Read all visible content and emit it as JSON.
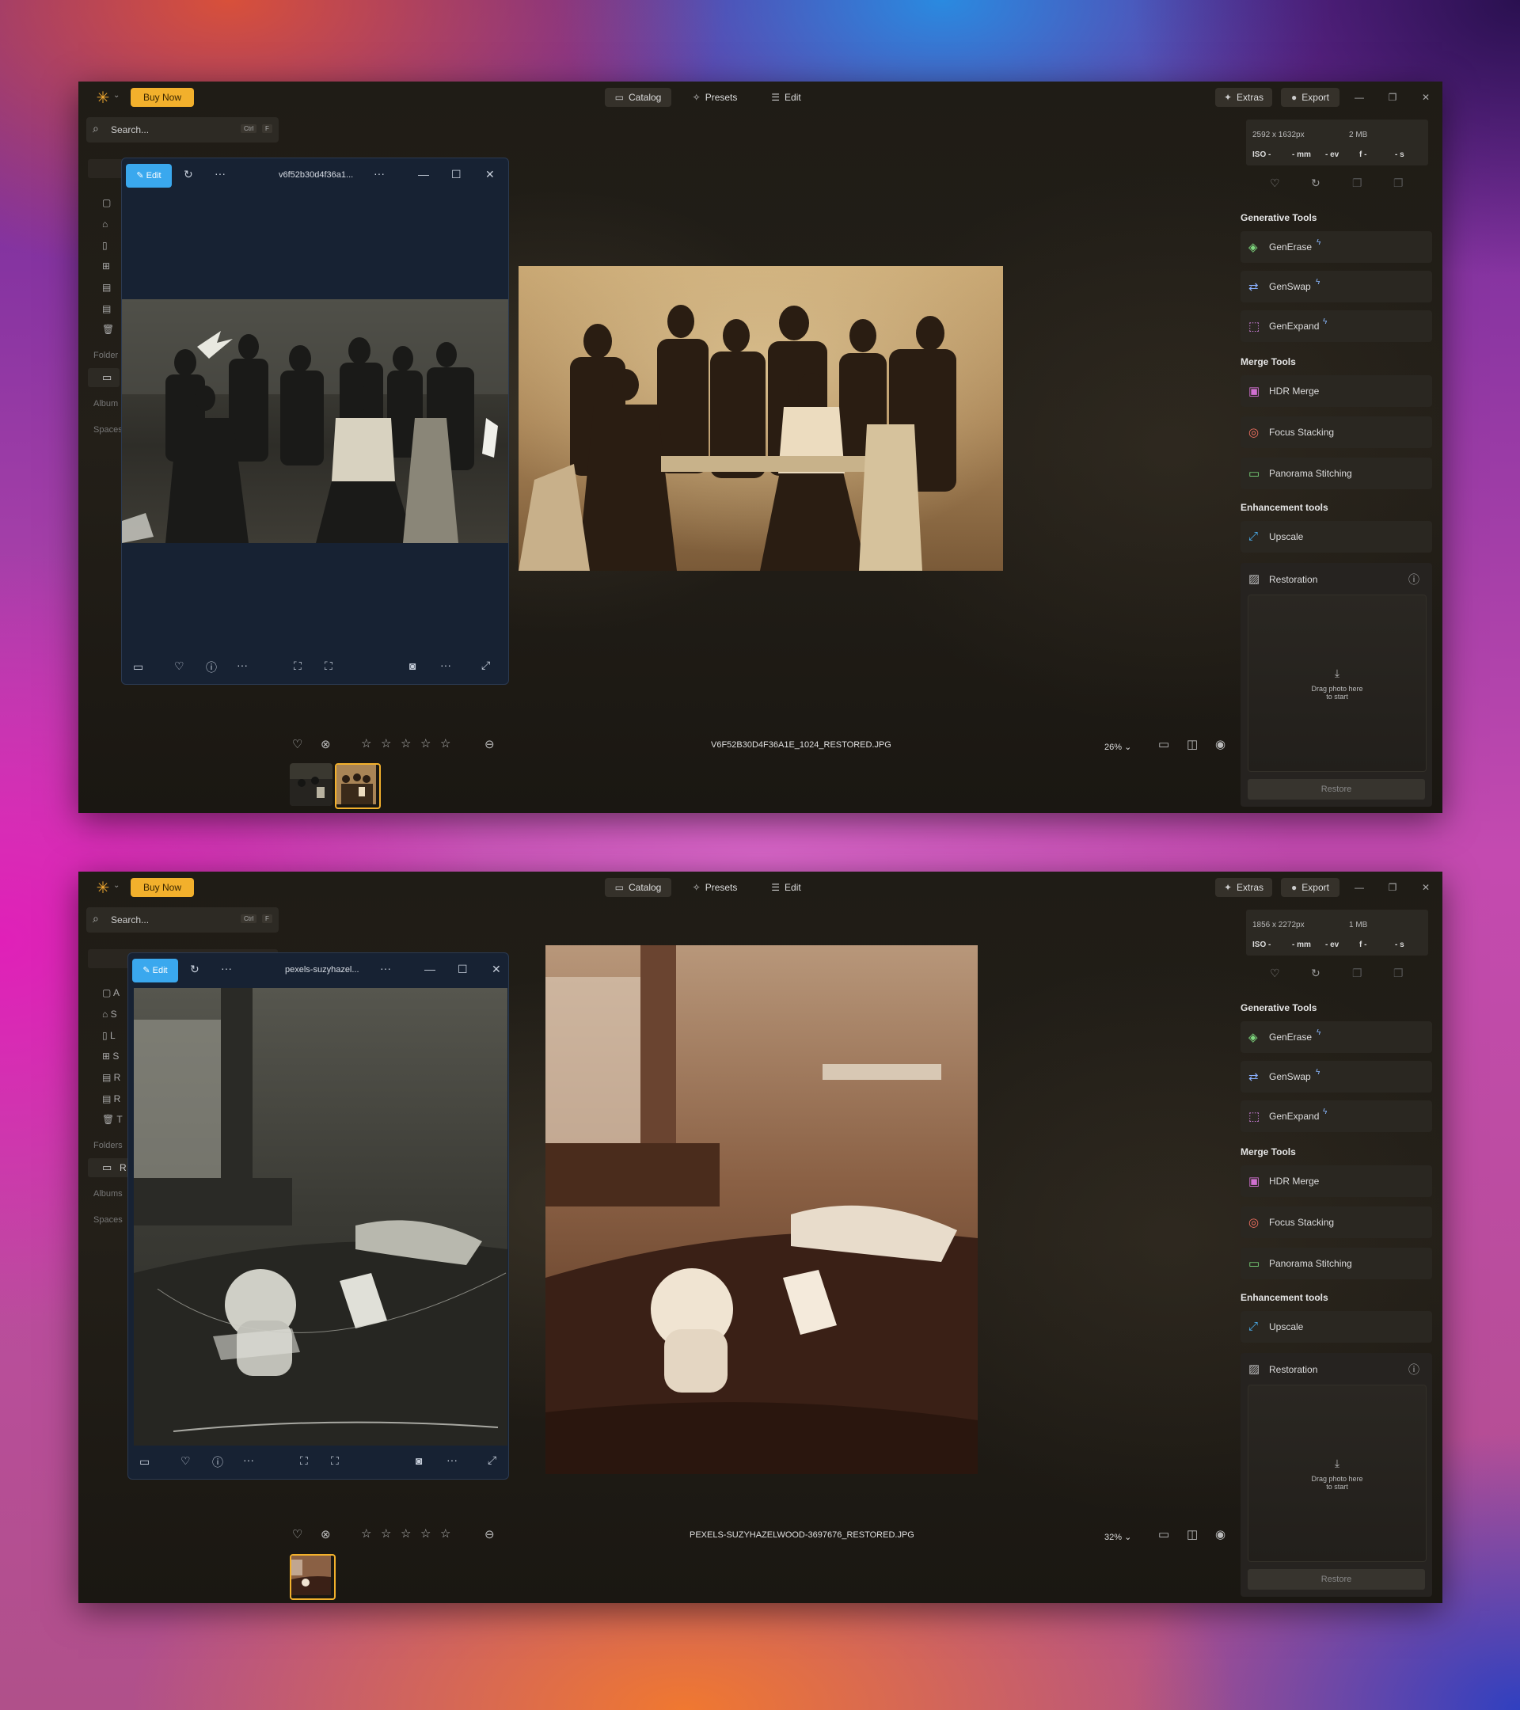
{
  "app": {
    "buy_now": "Buy Now",
    "search_placeholder": "Search...",
    "kbd_ctrl": "Ctrl",
    "kbd_f": "F",
    "nav": {
      "catalog": "Catalog",
      "presets": "Presets",
      "edit": "Edit"
    },
    "extras": "Extras",
    "export": "Export"
  },
  "sidebar": {
    "folders": "Folders",
    "albums": "Albums",
    "spaces": "Spaces",
    "w1_albums_cut": "Album",
    "w1_folders_cut": "Folder",
    "w2_item_letters": [
      "A",
      "S",
      "L",
      "S",
      "R",
      "R",
      "T"
    ],
    "w2_folder_letter": "R"
  },
  "viewer1": {
    "title": "v6f52b30d4f36a1...",
    "edit_label": "Edit"
  },
  "viewer2": {
    "title": "pexels-suzyhazel...",
    "edit_label": "Edit"
  },
  "window1": {
    "meta": {
      "resolution": "2592 x 1632px",
      "size": "2 MB",
      "iso": "ISO -",
      "mm": "- mm",
      "ev": "- ev",
      "f": "f -",
      "s": "- s"
    },
    "filename": "V6F52B30D4F36A1E_1024_RESTORED.JPG",
    "zoom": "26%"
  },
  "window2": {
    "meta": {
      "resolution": "1856 x 2272px",
      "size": "1 MB",
      "iso": "ISO -",
      "mm": "- mm",
      "ev": "- ev",
      "f": "f -",
      "s": "- s"
    },
    "filename": "PEXELS-SUZYHAZELWOOD-3697676_RESTORED.JPG",
    "zoom": "32%"
  },
  "tools": {
    "generative_title": "Generative Tools",
    "generative": [
      "GenErase",
      "GenSwap",
      "GenExpand"
    ],
    "merge_title": "Merge Tools",
    "merge": [
      "HDR Merge",
      "Focus Stacking",
      "Panorama Stitching"
    ],
    "enhancement_title": "Enhancement tools",
    "upscale": "Upscale",
    "restoration": "Restoration",
    "drop_line1": "Drag photo here",
    "drop_line2": "to start",
    "restore_button": "Restore"
  },
  "colors": {
    "accent": "#f2b02c",
    "edit_blue": "#3aa8ee"
  }
}
